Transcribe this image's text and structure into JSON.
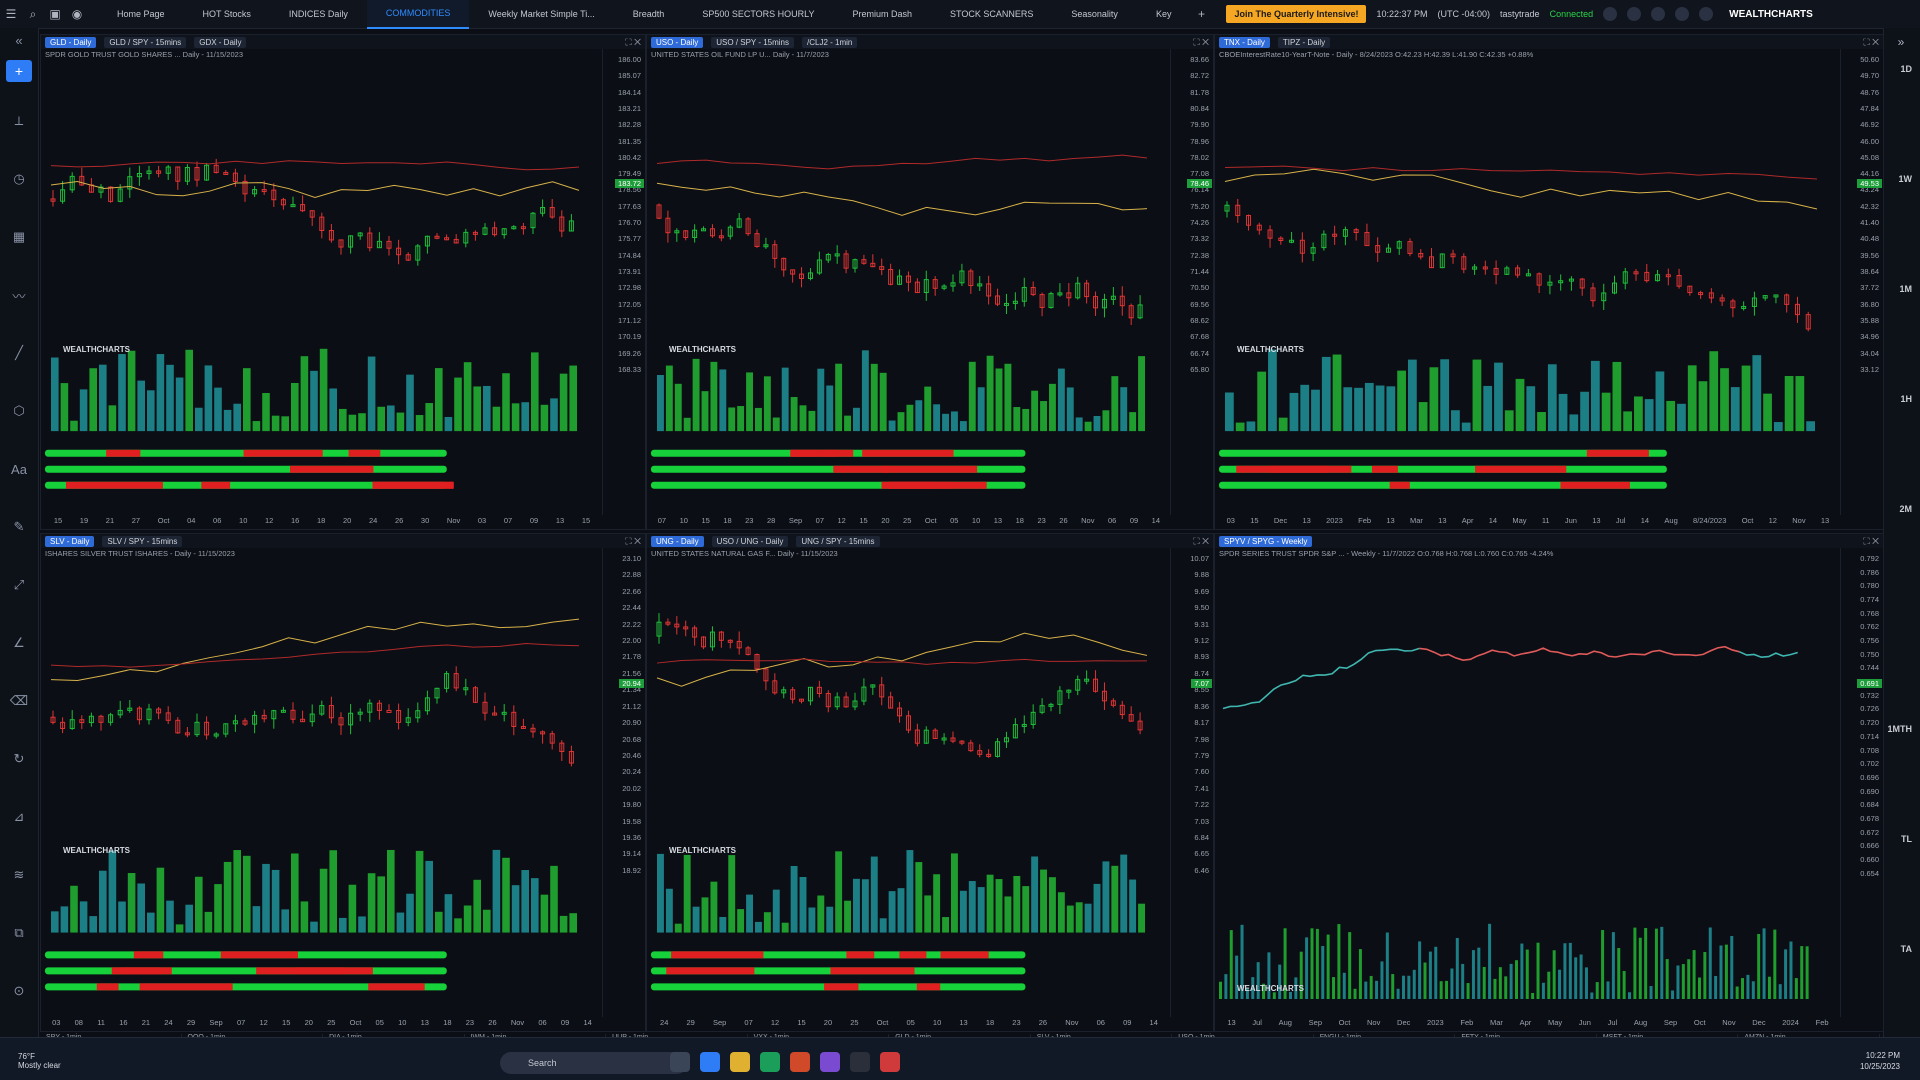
{
  "toolbar": {
    "tabs": [
      "Home Page",
      "HOT Stocks",
      "INDICES Daily",
      "COMMODITIES",
      "Weekly Market Simple Ti...",
      "Breadth",
      "SP500 SECTORS HOURLY",
      "Premium Dash",
      "STOCK SCANNERS",
      "Seasonality",
      "Key"
    ],
    "active_tab": "COMMODITIES",
    "promo": "Join The Quarterly Intensive!",
    "time": "10:22:37 PM",
    "timezone": "(UTC -04:00)",
    "broker": "tastytrade",
    "status": "Connected",
    "brand": "WEALTHCHARTS"
  },
  "timeframes": [
    "1D",
    "1W",
    "1M",
    "1H",
    "2M",
    "1MTH",
    "TL",
    "TA"
  ],
  "panels": [
    {
      "chips": [
        "GLD - Daily",
        "GLD / SPY - 15mins",
        "GDX - Daily"
      ],
      "subtitle": "SPDR GOLD TRUST GOLD SHARES ... Daily - 11/15/2023",
      "prices": [
        "186.00",
        "185.07",
        "184.14",
        "183.21",
        "182.28",
        "181.35",
        "180.42",
        "179.49",
        "178.56",
        "177.63",
        "176.70",
        "175.77",
        "174.84",
        "173.91",
        "172.98",
        "172.05",
        "171.12",
        "170.19",
        "169.26",
        "168.33"
      ],
      "tag": "183.72",
      "dates": [
        "15",
        "19",
        "21",
        "27",
        "Oct",
        "04",
        "06",
        "10",
        "12",
        "16",
        "18",
        "20",
        "24",
        "26",
        "30",
        "Nov",
        "03",
        "07",
        "09",
        "13",
        "15"
      ]
    },
    {
      "chips": [
        "USO - Daily",
        "USO / SPY - 15mins",
        "/CLJ2 - 1min"
      ],
      "subtitle": "UNITED STATES OIL FUND LP U... Daily - 11/7/2023",
      "prices": [
        "83.66",
        "82.72",
        "81.78",
        "80.84",
        "79.90",
        "78.96",
        "78.02",
        "77.08",
        "76.14",
        "75.20",
        "74.26",
        "73.32",
        "72.38",
        "71.44",
        "70.50",
        "69.56",
        "68.62",
        "67.68",
        "66.74",
        "65.80"
      ],
      "tag": "78.46",
      "dates": [
        "07",
        "10",
        "15",
        "18",
        "23",
        "28",
        "Sep",
        "07",
        "12",
        "15",
        "20",
        "25",
        "Oct",
        "05",
        "10",
        "13",
        "18",
        "23",
        "26",
        "Nov",
        "06",
        "09",
        "14"
      ]
    },
    {
      "chips": [
        "TNX - Daily",
        "TIPZ - Daily"
      ],
      "subtitle": "CBOEInterestRate10-YearT-Note - Daily - 8/24/2023 O:42.23 H:42.39 L:41.90 C:42.35 +0.88%",
      "prices": [
        "50.60",
        "49.70",
        "48.76",
        "47.84",
        "46.92",
        "46.00",
        "45.08",
        "44.16",
        "43.24",
        "42.32",
        "41.40",
        "40.48",
        "39.56",
        "38.64",
        "37.72",
        "36.80",
        "35.88",
        "34.96",
        "34.04",
        "33.12"
      ],
      "tag": "49.53",
      "dates": [
        "03",
        "15",
        "Dec",
        "13",
        "2023",
        "Feb",
        "13",
        "Mar",
        "13",
        "Apr",
        "14",
        "May",
        "11",
        "Jun",
        "13",
        "Jul",
        "14",
        "Aug",
        "8/24/2023",
        "Oct",
        "12",
        "Nov",
        "13"
      ]
    },
    {
      "chips": [
        "SLV - Daily",
        "SLV / SPY - 15mins"
      ],
      "subtitle": "ISHARES SILVER TRUST ISHARES - Daily - 11/15/2023",
      "prices": [
        "23.10",
        "22.88",
        "22.66",
        "22.44",
        "22.22",
        "22.00",
        "21.78",
        "21.56",
        "21.34",
        "21.12",
        "20.90",
        "20.68",
        "20.46",
        "20.24",
        "20.02",
        "19.80",
        "19.58",
        "19.36",
        "19.14",
        "18.92"
      ],
      "tag": "20.94",
      "dates": [
        "03",
        "08",
        "11",
        "16",
        "21",
        "24",
        "29",
        "Sep",
        "07",
        "12",
        "15",
        "20",
        "25",
        "Oct",
        "05",
        "10",
        "13",
        "18",
        "23",
        "26",
        "Nov",
        "06",
        "09",
        "14"
      ]
    },
    {
      "chips": [
        "UNG - Daily",
        "USO / UNG - Daily",
        "UNG / SPY - 15mins"
      ],
      "subtitle": "UNITED STATES NATURAL GAS F... Daily - 11/15/2023",
      "prices": [
        "10.07",
        "9.88",
        "9.69",
        "9.50",
        "9.31",
        "9.12",
        "8.93",
        "8.74",
        "8.55",
        "8.36",
        "8.17",
        "7.98",
        "7.79",
        "7.60",
        "7.41",
        "7.22",
        "7.03",
        "6.84",
        "6.65",
        "6.46"
      ],
      "tag": "7.07",
      "dates": [
        "24",
        "29",
        "Sep",
        "07",
        "12",
        "15",
        "20",
        "25",
        "Oct",
        "05",
        "10",
        "13",
        "18",
        "23",
        "26",
        "Nov",
        "06",
        "09",
        "14"
      ]
    },
    {
      "chips": [
        "SPYV / SPYG - Weekly"
      ],
      "subtitle": "SPDR SERIES TRUST SPDR S&P ... - Weekly - 11/7/2022 O:0.768 H:0.768 L:0.760 C:0.765 -4.24%",
      "prices": [
        "0.792",
        "0.786",
        "0.780",
        "0.774",
        "0.768",
        "0.762",
        "0.756",
        "0.750",
        "0.744",
        "0.738",
        "0.732",
        "0.726",
        "0.720",
        "0.714",
        "0.708",
        "0.702",
        "0.696",
        "0.690",
        "0.684",
        "0.678",
        "0.672",
        "0.666",
        "0.660",
        "0.654"
      ],
      "tag": "0.691",
      "dates": [
        "13",
        "Jul",
        "Aug",
        "Sep",
        "Oct",
        "Nov",
        "Dec",
        "2023",
        "Feb",
        "Mar",
        "Apr",
        "May",
        "Jun",
        "Jul",
        "Aug",
        "Sep",
        "Oct",
        "Nov",
        "Dec",
        "2024",
        "Feb"
      ]
    }
  ],
  "watermark": "WEALTHCHARTS",
  "quote_strip": [
    "SPY - 1min",
    "QQQ - 1min",
    "DIA - 1min",
    "IWM - 1min",
    "UUP - 1min",
    "VXX - 1min",
    "GLD - 1min",
    "SLV - 1min",
    "USO - 1min",
    "FNGU - 1min",
    "FFTY - 1min",
    "MSFT - 1min",
    "AMZN - 1min"
  ],
  "taskbar": {
    "weather": "76°F",
    "weather_sub": "Mostly clear",
    "search": "Search",
    "time": "10:22 PM",
    "date": "10/25/2023"
  }
}
